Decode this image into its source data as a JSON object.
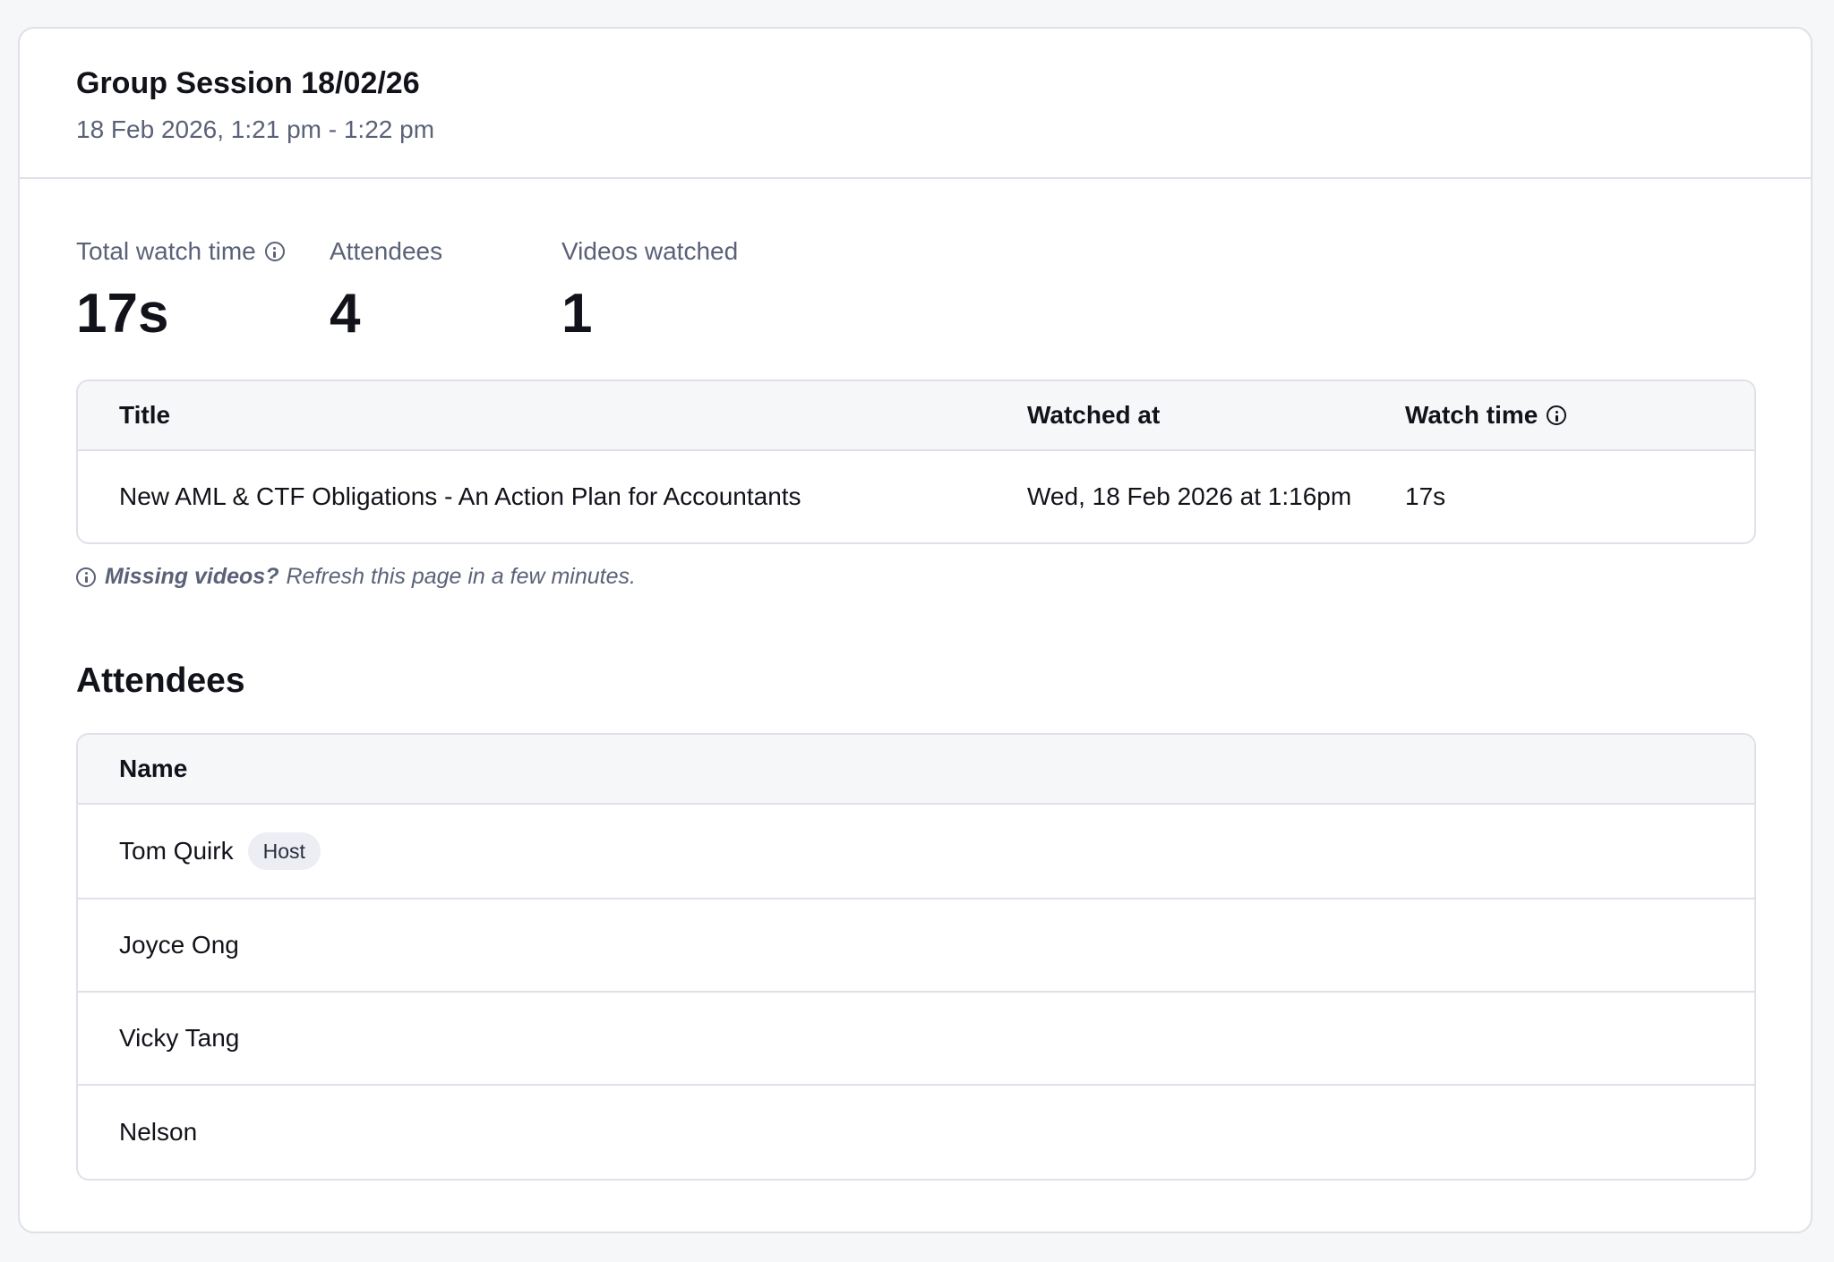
{
  "session": {
    "title": "Group Session 18/02/26",
    "date_range": "18 Feb 2026, 1:21 pm - 1:22 pm"
  },
  "stats": {
    "total_watch_time_label": "Total watch time",
    "total_watch_time_value": "17s",
    "attendees_label": "Attendees",
    "attendees_value": "4",
    "videos_watched_label": "Videos watched",
    "videos_watched_value": "1"
  },
  "videos_table": {
    "headers": {
      "title": "Title",
      "watched_at": "Watched at",
      "watch_time": "Watch time"
    },
    "rows": [
      {
        "title": "New AML & CTF Obligations - An Action Plan for Accountants",
        "watched_at": "Wed, 18 Feb 2026 at 1:16pm",
        "watch_time": "17s"
      }
    ]
  },
  "missing_note": {
    "bold": "Missing videos?",
    "text": "Refresh this page in a few minutes."
  },
  "attendees_section": {
    "title": "Attendees",
    "header_name": "Name",
    "rows": [
      {
        "name": "Tom Quirk",
        "badge": "Host"
      },
      {
        "name": "Joyce Ong"
      },
      {
        "name": "Vicky Tang"
      },
      {
        "name": "Nelson"
      }
    ]
  },
  "icons": {
    "total_watch_time_info": "info-icon",
    "watch_time_info": "info-icon",
    "missing_note_info": "info-icon"
  },
  "colors": {
    "background": "#f6f7f9",
    "card": "#ffffff",
    "border": "#dfe1e8",
    "muted_text": "#5b6278",
    "badge_bg": "#eceef4"
  }
}
